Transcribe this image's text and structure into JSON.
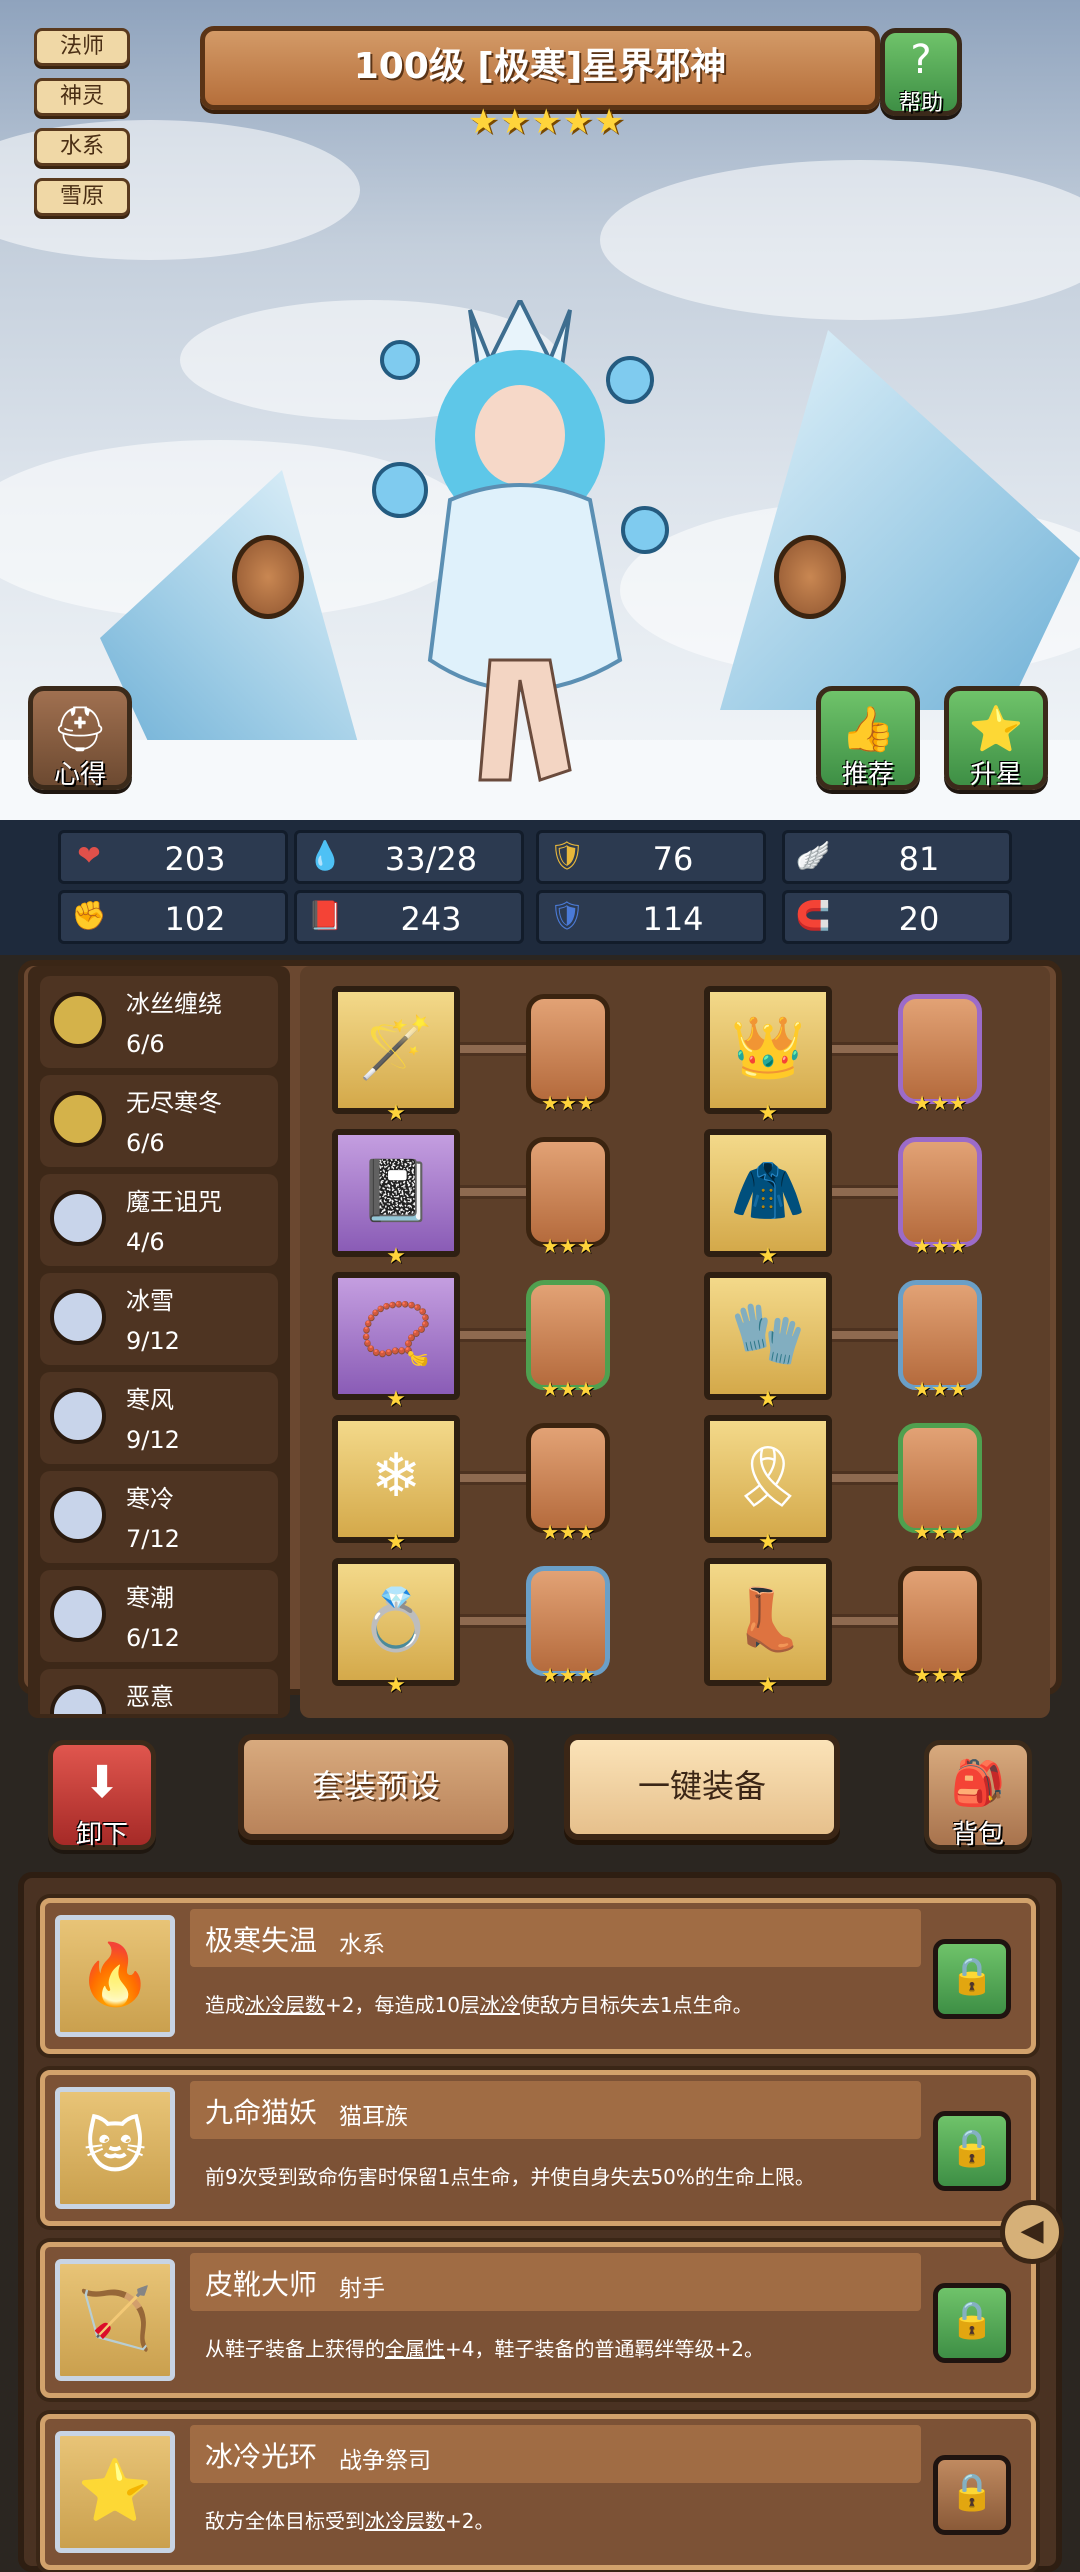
{
  "tags": [
    "法师",
    "神灵",
    "水系",
    "雪原"
  ],
  "hero": {
    "title": "100级 [极寒]星界邪神",
    "stars": "★★★★★"
  },
  "buttons": {
    "help": "帮助",
    "insight": "心得",
    "recommend": "推荐",
    "star_up": "升星",
    "unequip": "卸下",
    "preset": "套装预设",
    "one_key": "一键装备",
    "bag": "背包"
  },
  "stats": [
    {
      "icon": "heart-icon",
      "glyph": "❤",
      "color": "#e0504a",
      "value": "203"
    },
    {
      "icon": "mana-drop-icon",
      "glyph": "💧",
      "color": "#6bb6e8",
      "value": "33/28"
    },
    {
      "icon": "shield-icon",
      "glyph": "🛡",
      "color": "#e8b73a",
      "value": "76"
    },
    {
      "icon": "wing-icon",
      "glyph": "🪽",
      "color": "#ffffff",
      "value": "81"
    },
    {
      "icon": "fist-icon",
      "glyph": "✊",
      "color": "#e09a7a",
      "value": "102"
    },
    {
      "icon": "spellbook-icon",
      "glyph": "📕",
      "color": "#c0403a",
      "value": "243"
    },
    {
      "icon": "magic-defense-icon",
      "glyph": "🛡",
      "color": "#4a7ad8",
      "value": "114"
    },
    {
      "icon": "horseshoe-icon",
      "glyph": "🧲",
      "color": "#e8b73a",
      "value": "20"
    }
  ],
  "sets": [
    {
      "name": "冰丝缠绕",
      "count": "6/6",
      "color": "#d4b24a"
    },
    {
      "name": "无尽寒冬",
      "count": "6/6",
      "color": "#d4b24a"
    },
    {
      "name": "魔王诅咒",
      "count": "4/6",
      "color": "#c8d4ea"
    },
    {
      "name": "冰雪",
      "count": "9/12",
      "color": "#c8d4ea"
    },
    {
      "name": "寒风",
      "count": "9/12",
      "color": "#c8d4ea"
    },
    {
      "name": "寒冷",
      "count": "7/12",
      "color": "#c8d4ea"
    },
    {
      "name": "寒潮",
      "count": "6/12",
      "color": "#c8d4ea"
    },
    {
      "name": "恶意",
      "count": "",
      "color": "#c8d4ea"
    }
  ],
  "equipment": [
    {
      "item": "staff",
      "glyph": "🪄",
      "frame": "gold",
      "gem": "gold",
      "stars": "★",
      "gem_stars": "★★★"
    },
    {
      "item": "crown",
      "glyph": "👑",
      "frame": "gold",
      "gem": "purple",
      "stars": "★",
      "gem_stars": "★★★"
    },
    {
      "item": "book",
      "glyph": "📓",
      "frame": "purp",
      "gem": "gold",
      "stars": "★",
      "gem_stars": "★★★"
    },
    {
      "item": "robe",
      "glyph": "🧥",
      "frame": "gold",
      "gem": "purple",
      "stars": "★",
      "gem_stars": "★★★"
    },
    {
      "item": "necklace",
      "glyph": "📿",
      "frame": "purp",
      "gem": "green",
      "stars": "★",
      "gem_stars": "★★★"
    },
    {
      "item": "glove",
      "glyph": "🧤",
      "frame": "gold",
      "gem": "blue",
      "stars": "★",
      "gem_stars": "★★★"
    },
    {
      "item": "orb",
      "glyph": "❄",
      "frame": "gold",
      "gem": "gold",
      "stars": "★",
      "gem_stars": "★★★"
    },
    {
      "item": "belt",
      "glyph": "🎗",
      "frame": "gold",
      "gem": "green",
      "stars": "★",
      "gem_stars": "★★★"
    },
    {
      "item": "ring",
      "glyph": "💍",
      "frame": "gold",
      "gem": "blue",
      "stars": "★",
      "gem_stars": "★★★"
    },
    {
      "item": "boots",
      "glyph": "👢",
      "frame": "gold",
      "gem": "gold",
      "stars": "★",
      "gem_stars": "★★★"
    }
  ],
  "bonds": [
    {
      "name": "极寒失温",
      "tag": "水系",
      "icon": "flame-icon",
      "glyph": "🔥",
      "desc": [
        "造成",
        "冰冷层数",
        "+2，每造成10层",
        "冰冷",
        "使敌方目标失去1点生命。"
      ],
      "locked_color": "green"
    },
    {
      "name": "九命猫妖",
      "tag": "猫耳族",
      "icon": "cat-icon",
      "glyph": "🐱",
      "desc": [
        "前9次受到致命伤害时保留1点生命，并使自身失去50%的生命上限。",
        "",
        "",
        "",
        ""
      ],
      "locked_color": "green"
    },
    {
      "name": "皮靴大师",
      "tag": "射手",
      "icon": "bow-icon",
      "glyph": "🏹",
      "desc": [
        "从鞋子装备上获得的",
        "全属性",
        "+4，鞋子装备的普通羁绊等级+2。",
        "",
        ""
      ],
      "locked_color": "green"
    },
    {
      "name": "冰冷光环",
      "tag": "战争祭司",
      "icon": "star-icon",
      "glyph": "⭐",
      "desc": [
        "敌方全体目标受到",
        "冰冷层数",
        "+2。",
        "",
        ""
      ],
      "locked_color": "brown"
    }
  ]
}
